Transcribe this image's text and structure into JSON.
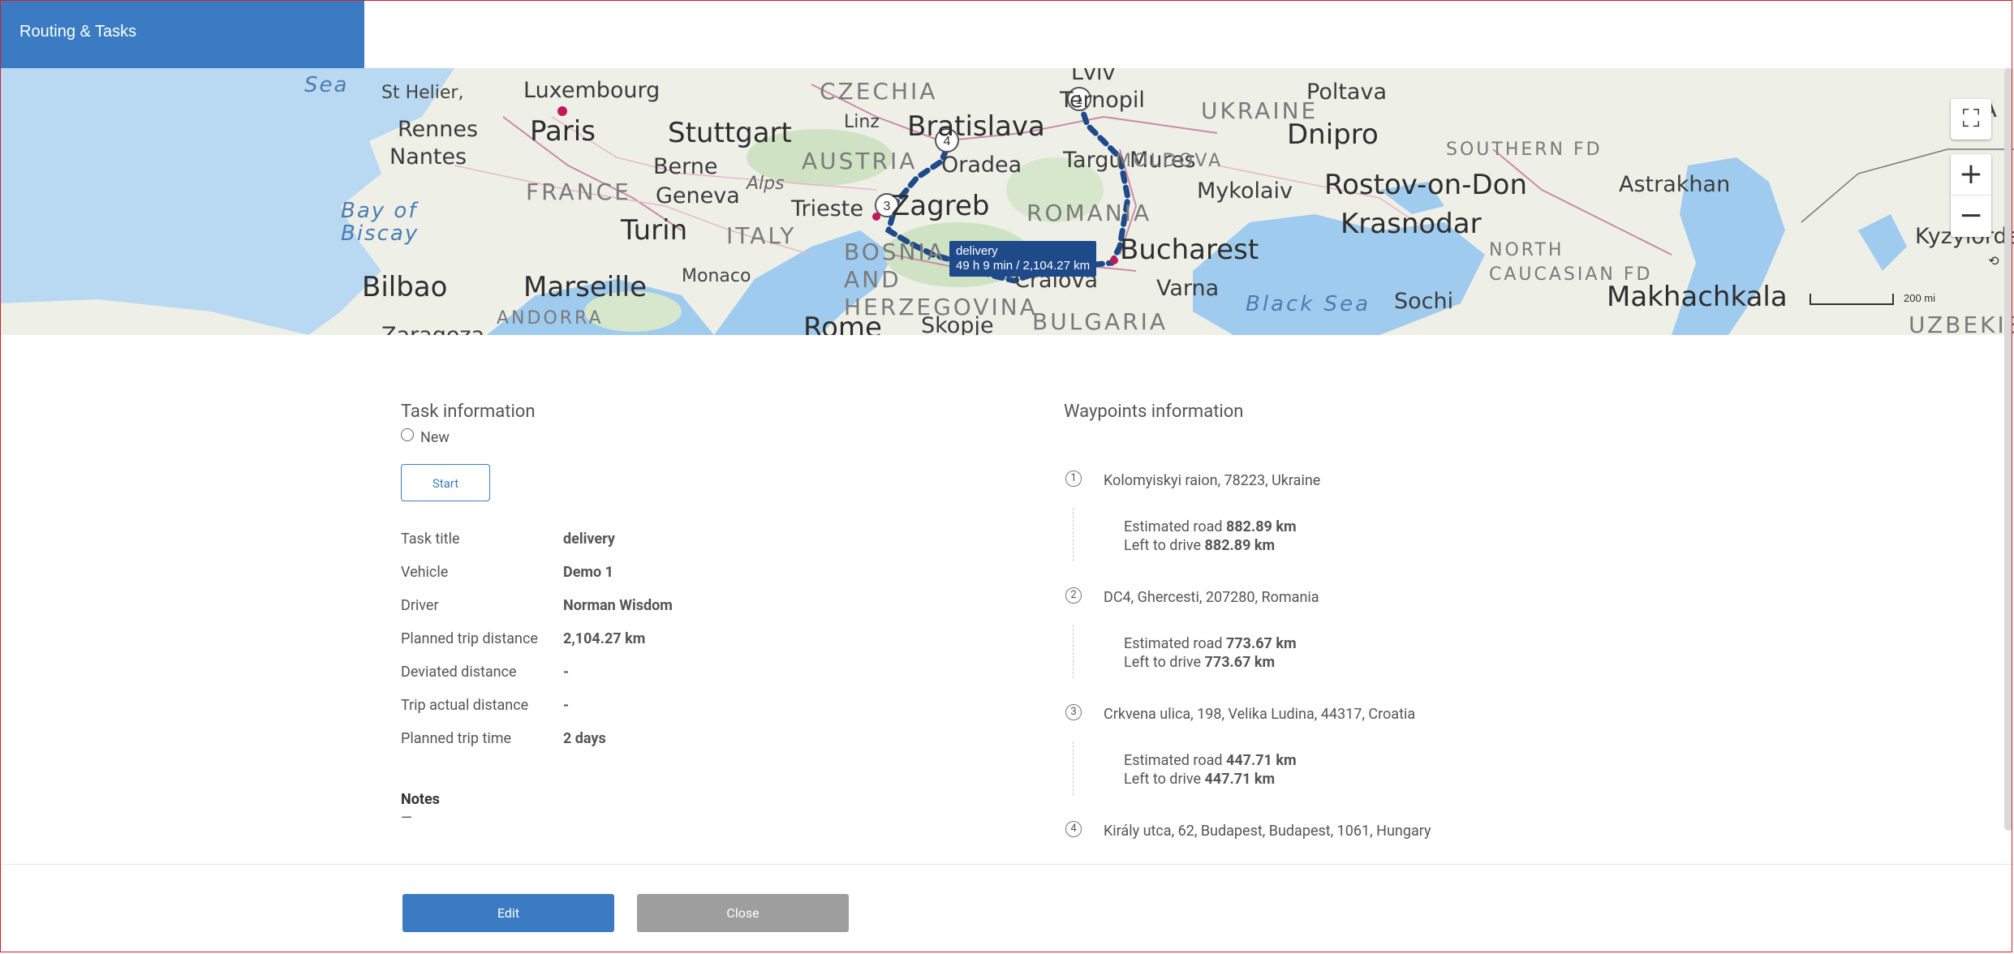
{
  "app": {
    "title": "Routing & Tasks"
  },
  "map": {
    "labels": {
      "sea1": "Sea",
      "st_helier": "St Helier,",
      "luxembourg": "Luxembourg",
      "czechia": "CZECHIA",
      "lviv": "Lviv",
      "poltava": "Poltava",
      "ukraine": "UKRAINE",
      "rennes": "Rennes",
      "paris": "Paris",
      "stuttgart": "Stuttgart",
      "linz": "Linz",
      "bratislava": "Bratislava",
      "ternopil": "Ternopil",
      "dnipro": "Dnipro",
      "southern_fd": "SOUTHERN FD",
      "nantes": "Nantes",
      "berne": "Berne",
      "austria": "AUSTRIA",
      "oradea": "Oradea",
      "targu_mures": "Targu Mures",
      "moldova": "MOLDOVA",
      "rostov": "Rostov-on-Don",
      "astrakhan": "Astrakhan",
      "france": "FRANCE",
      "geneva": "Geneva",
      "alps": "Alps",
      "trieste": "Trieste",
      "zagreb": "Zagreb",
      "romania": "ROMANIA",
      "mykolaiv": "Mykolaiv",
      "bay_of_biscay": "Bay of Biscay",
      "turin": "Turin",
      "italy": "ITALY",
      "krasnodar": "Krasnodar",
      "kyzylorda": "Kyzylorda",
      "bosnia": "BOSNIA AND HERZEGOVINA",
      "bucharest": "Bucharest",
      "north_caucasian": "NORTH CAUCASIAN FD",
      "bilbao": "Bilbao",
      "marseille": "Marseille",
      "monaco": "Monaco",
      "craiova": "Craiova",
      "varna": "Varna",
      "black_sea": "Black Sea",
      "sochi": "Sochi",
      "makhachkala": "Makhachkala",
      "andorra": "ANDORRA",
      "rome": "Rome",
      "skopje": "Skopje",
      "bulgaria": "BULGARIA",
      "uzbekistan": "UZBEKISTAN",
      "zaragoza": "Zaragoza",
      "kaz": "KA"
    },
    "markers": [
      "1",
      "4",
      "3"
    ],
    "tooltip": {
      "title": "delivery",
      "detail": "49 h 9 min / 2,104.27 km"
    },
    "scale_label": "200 mi",
    "controls": {
      "fullscreen": "⛶",
      "zoom_in": "+",
      "zoom_out": "−"
    }
  },
  "task": {
    "heading": "Task information",
    "status": "New",
    "start_label": "Start",
    "rows": [
      {
        "key": "Task title",
        "value": "delivery"
      },
      {
        "key": "Vehicle",
        "value": "Demo 1"
      },
      {
        "key": "Driver",
        "value": "Norman Wisdom"
      },
      {
        "key": "Planned trip distance",
        "value": "2,104.27 km"
      },
      {
        "key": "Deviated distance",
        "value": "-"
      },
      {
        "key": "Trip actual distance",
        "value": "-"
      },
      {
        "key": "Planned trip time",
        "value": "2 days"
      }
    ],
    "notes_title": "Notes",
    "notes_value": "—"
  },
  "waypoints": {
    "heading": "Waypoints information",
    "est_label": "Estimated road",
    "left_label": "Left to drive",
    "items": [
      {
        "num": "1",
        "address": "Kolomyiskyi raion, 78223, Ukraine",
        "estimated": "882.89 km",
        "left": "882.89 km"
      },
      {
        "num": "2",
        "address": "DC4, Ghercesti, 207280, Romania",
        "estimated": "773.67 km",
        "left": "773.67 km"
      },
      {
        "num": "3",
        "address": "Crkvena ulica, 198, Velika Ludina, 44317, Croatia",
        "estimated": "447.71 km",
        "left": "447.71 km"
      },
      {
        "num": "4",
        "address": "Király utca, 62, Budapest, Budapest, 1061, Hungary"
      }
    ]
  },
  "footer": {
    "edit_label": "Edit",
    "close_label": "Close"
  },
  "colors": {
    "brand": "#3b7bc3",
    "route": "#1f4a8a",
    "close_btn": "#9e9e9e",
    "frame": "#d21f2a"
  }
}
